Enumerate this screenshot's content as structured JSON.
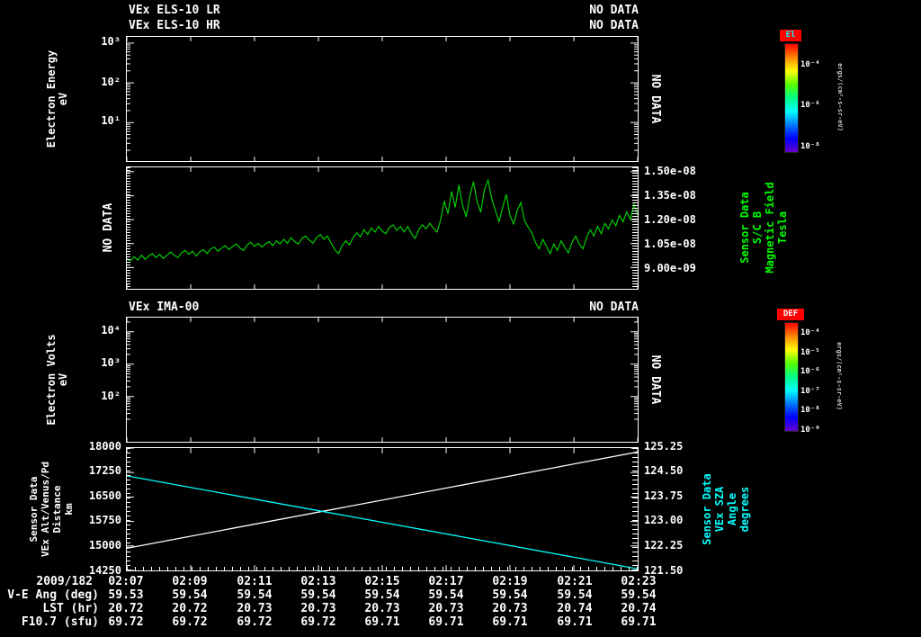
{
  "colors": {
    "background": "#000000",
    "axis": "#ffffff",
    "mag_line": "#00dd00",
    "mag_label": "#00ff00",
    "altitude_line": "#ffffff",
    "sza_line": "#00ffff",
    "sza_label": "#00ffff",
    "colorbar_chip_bg": "#ff0000",
    "els_chip_text": "#00ffff",
    "ima_chip_text": "#ffffff"
  },
  "xaxis": {
    "date": "2009/182",
    "ticks": [
      "02:07",
      "02:09",
      "02:11",
      "02:13",
      "02:15",
      "02:17",
      "02:19",
      "02:21",
      "02:23"
    ]
  },
  "table": {
    "rows": [
      {
        "label": "V-E Ang (deg)",
        "values": [
          "59.53",
          "59.54",
          "59.54",
          "59.54",
          "59.54",
          "59.54",
          "59.54",
          "59.54",
          "59.54"
        ]
      },
      {
        "label": "LST (hr)",
        "values": [
          "20.72",
          "20.72",
          "20.73",
          "20.73",
          "20.73",
          "20.73",
          "20.73",
          "20.74",
          "20.74"
        ]
      },
      {
        "label": "F10.7 (sfu)",
        "values": [
          "69.72",
          "69.72",
          "69.72",
          "69.72",
          "69.71",
          "69.71",
          "69.71",
          "69.71",
          "69.71"
        ]
      }
    ]
  },
  "chart_data": [
    {
      "panel": "els-spectrogram",
      "type": "heatmap",
      "titles": [
        "VEx ELS-10 LR",
        "VEx ELS-10 HR"
      ],
      "status": [
        "NO DATA",
        "NO DATA"
      ],
      "ylabel_lines": [
        "Electron Energy",
        "eV"
      ],
      "yscale": "log",
      "yticks": [
        "10³",
        "10²",
        "10¹"
      ],
      "no_data": "NO DATA",
      "values": [],
      "colorbar": {
        "title": "El",
        "ticks": [
          "10⁻⁴",
          "10⁻⁶",
          "10⁻⁸"
        ],
        "units": "ergs/(cm²-s-sr-eV)",
        "colors": [
          "#ff0000",
          "#ff8800",
          "#ffff00",
          "#55ff00",
          "#00ff88",
          "#00ffff",
          "#0077ff",
          "#0000ff",
          "#6a00c8"
        ]
      }
    },
    {
      "panel": "magnetic-field",
      "type": "line",
      "left_note": "NO DATA",
      "right_label_lines": [
        "Sensor Data",
        "S/C B",
        "Magnetic Field",
        "Tesla"
      ],
      "yticks": [
        "1.50e-08",
        "1.35e-08",
        "1.20e-08",
        "1.05e-08",
        "9.00e-09"
      ],
      "ylim": [
        7.7e-09,
        1.53e-08
      ],
      "x_range": [
        "02:07",
        "02:23"
      ],
      "series": [
        {
          "name": "sc-b-magnetic-field-tesla",
          "color": "#00dd00",
          "scale": 1e-09,
          "values": [
            9.6,
            9.45,
            9.7,
            9.5,
            9.8,
            9.55,
            9.75,
            9.9,
            9.65,
            9.85,
            9.6,
            9.8,
            10.0,
            9.8,
            9.65,
            9.95,
            10.1,
            9.85,
            10.05,
            9.75,
            10.0,
            10.15,
            9.9,
            10.2,
            10.3,
            10.05,
            10.25,
            10.4,
            10.15,
            10.35,
            10.5,
            10.25,
            10.1,
            10.45,
            10.6,
            10.35,
            10.55,
            10.3,
            10.5,
            10.65,
            10.4,
            10.7,
            10.5,
            10.8,
            10.55,
            10.9,
            10.65,
            10.5,
            10.85,
            11.0,
            10.75,
            10.55,
            10.9,
            11.1,
            10.8,
            11.0,
            10.55,
            10.15,
            9.9,
            10.4,
            10.7,
            10.45,
            10.9,
            11.2,
            10.95,
            11.4,
            11.1,
            11.5,
            11.25,
            11.6,
            11.3,
            11.15,
            11.55,
            11.7,
            11.35,
            11.6,
            11.25,
            11.6,
            11.15,
            10.85,
            11.4,
            11.7,
            11.45,
            11.8,
            11.5,
            11.25,
            12.0,
            13.2,
            12.4,
            13.8,
            12.8,
            14.2,
            12.95,
            12.2,
            13.5,
            14.4,
            13.15,
            12.5,
            13.9,
            14.5,
            13.35,
            12.6,
            11.9,
            12.8,
            13.6,
            12.3,
            11.75,
            12.6,
            13.1,
            11.95,
            11.55,
            11.2,
            10.6,
            10.2,
            10.8,
            10.35,
            9.9,
            10.5,
            10.1,
            10.7,
            10.3,
            9.95,
            10.6,
            11.0,
            10.5,
            10.2,
            10.9,
            11.4,
            11.0,
            11.6,
            11.15,
            11.8,
            11.45,
            12.0,
            11.65,
            12.3,
            11.9,
            12.5,
            12.05,
            13.0,
            12.3
          ]
        }
      ]
    },
    {
      "panel": "ima-spectrogram",
      "type": "heatmap",
      "titles": [
        "VEx IMA-00"
      ],
      "status": [
        "NO DATA"
      ],
      "ylabel_lines": [
        "Electron Volts",
        "eV"
      ],
      "yscale": "log",
      "yticks": [
        "10⁴",
        "10³",
        "10²"
      ],
      "no_data": "NO DATA",
      "values": [],
      "colorbar": {
        "title": "DEF",
        "ticks": [
          "10⁻⁴",
          "10⁻⁵",
          "10⁻⁶",
          "10⁻⁷",
          "10⁻⁸",
          "10⁻⁹"
        ],
        "units": "ergs/(cm²-s-sr-eV)",
        "colors": [
          "#ff0000",
          "#ff8800",
          "#ffff00",
          "#55ff00",
          "#00ff88",
          "#00ffff",
          "#0077ff",
          "#0000ff",
          "#6a00c8"
        ]
      }
    },
    {
      "panel": "trajectory",
      "type": "line",
      "left_label_lines": [
        "Sensor Data",
        "VEx Alt/Venus/Pd",
        "Distance",
        "km"
      ],
      "yticks_left": [
        "18000",
        "17250",
        "16500",
        "15750",
        "15000",
        "14250"
      ],
      "ylim_left": [
        14250,
        18000
      ],
      "right_label_lines": [
        "Sensor Data",
        "VEx SZA",
        "Angle",
        "degrees"
      ],
      "yticks_right": [
        "125.25",
        "124.50",
        "123.75",
        "123.00",
        "122.25",
        "121.50"
      ],
      "ylim_right": [
        121.5,
        125.25
      ],
      "series": [
        {
          "name": "vex-altitude-km",
          "color": "#ffffff",
          "axis": "left",
          "x": [
            0,
            1
          ],
          "values": [
            14930,
            17880
          ]
        },
        {
          "name": "vex-sza-degrees",
          "color": "#00ffff",
          "axis": "right",
          "x": [
            0,
            1
          ],
          "values": [
            124.4,
            121.55
          ]
        }
      ]
    }
  ]
}
